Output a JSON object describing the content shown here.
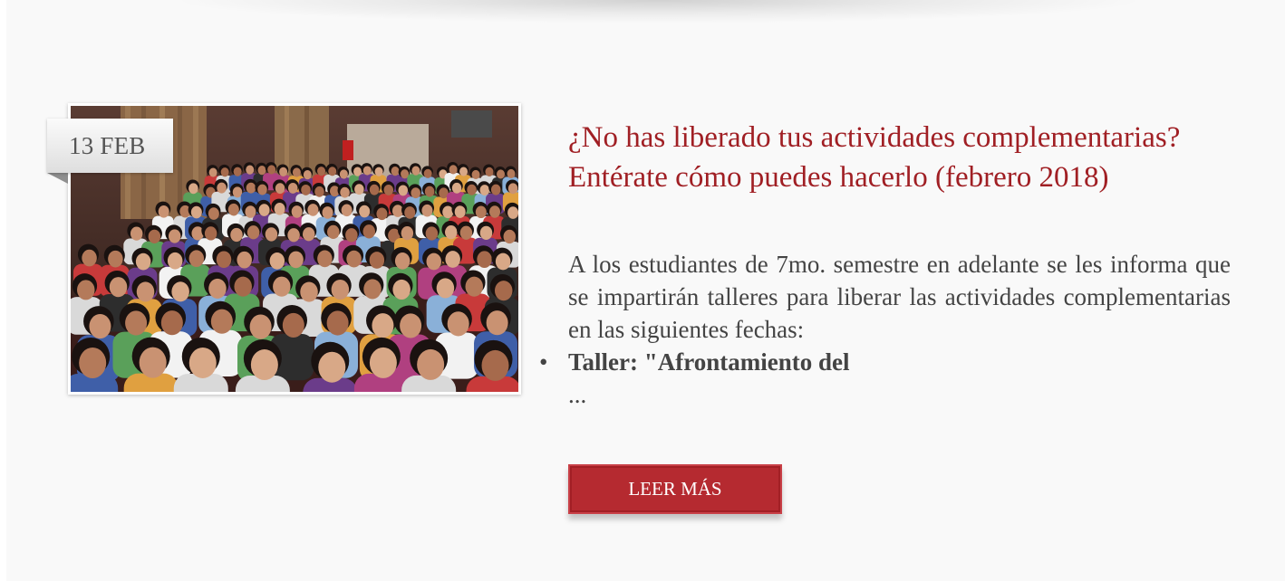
{
  "post": {
    "date": "13 FEB",
    "title": "¿No has liberado tus actividades complementarias? Entérate cómo puedes hacerlo (febrero 2018)",
    "excerpt": "A los estudiantes de 7mo. semestre en adelante se les informa que se impartirán talleres para liberar las actividades complementarias en las siguientes fechas:",
    "list_item": "Taller: \"Afrontamiento del",
    "ellipsis": "...",
    "read_more_label": "LEER MÁS"
  },
  "colors": {
    "accent": "#a01f24",
    "button": "#b52a30",
    "background": "#f9f9f9",
    "text": "#444444"
  }
}
